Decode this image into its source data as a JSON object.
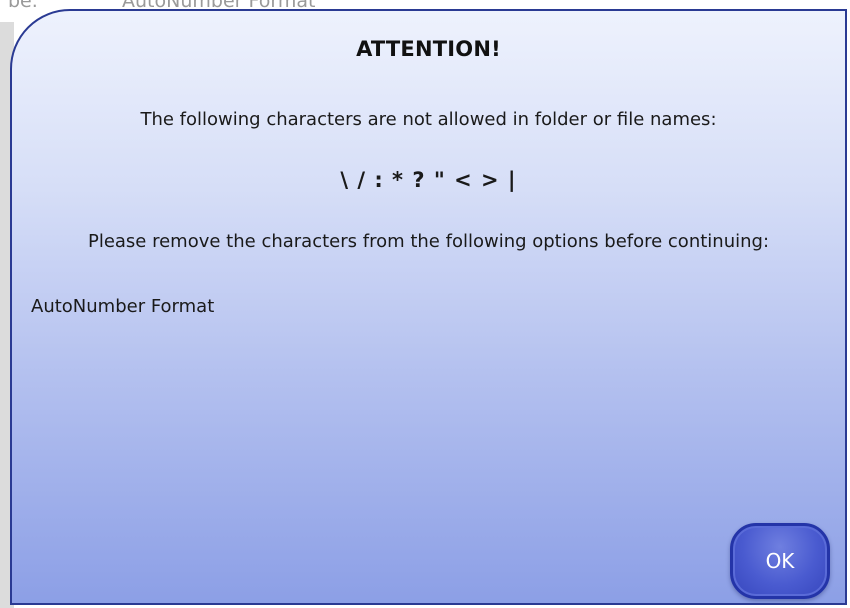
{
  "background": {
    "left_text": "be.",
    "right_text": "AutoNumber Format"
  },
  "dialog": {
    "title": "ATTENTION!",
    "message": "The following characters are not allowed in folder or file names:",
    "forbidden_characters": "\\ / : * ? \" < > |",
    "instruction": "Please remove the characters from the following options before continuing:",
    "options": [
      "AutoNumber Format"
    ],
    "ok_label": "OK"
  },
  "colors": {
    "border": "#2a3a93",
    "gradient_top": "#eef2fd",
    "gradient_bottom": "#8c9fe6",
    "button": "#4a5bd0"
  }
}
